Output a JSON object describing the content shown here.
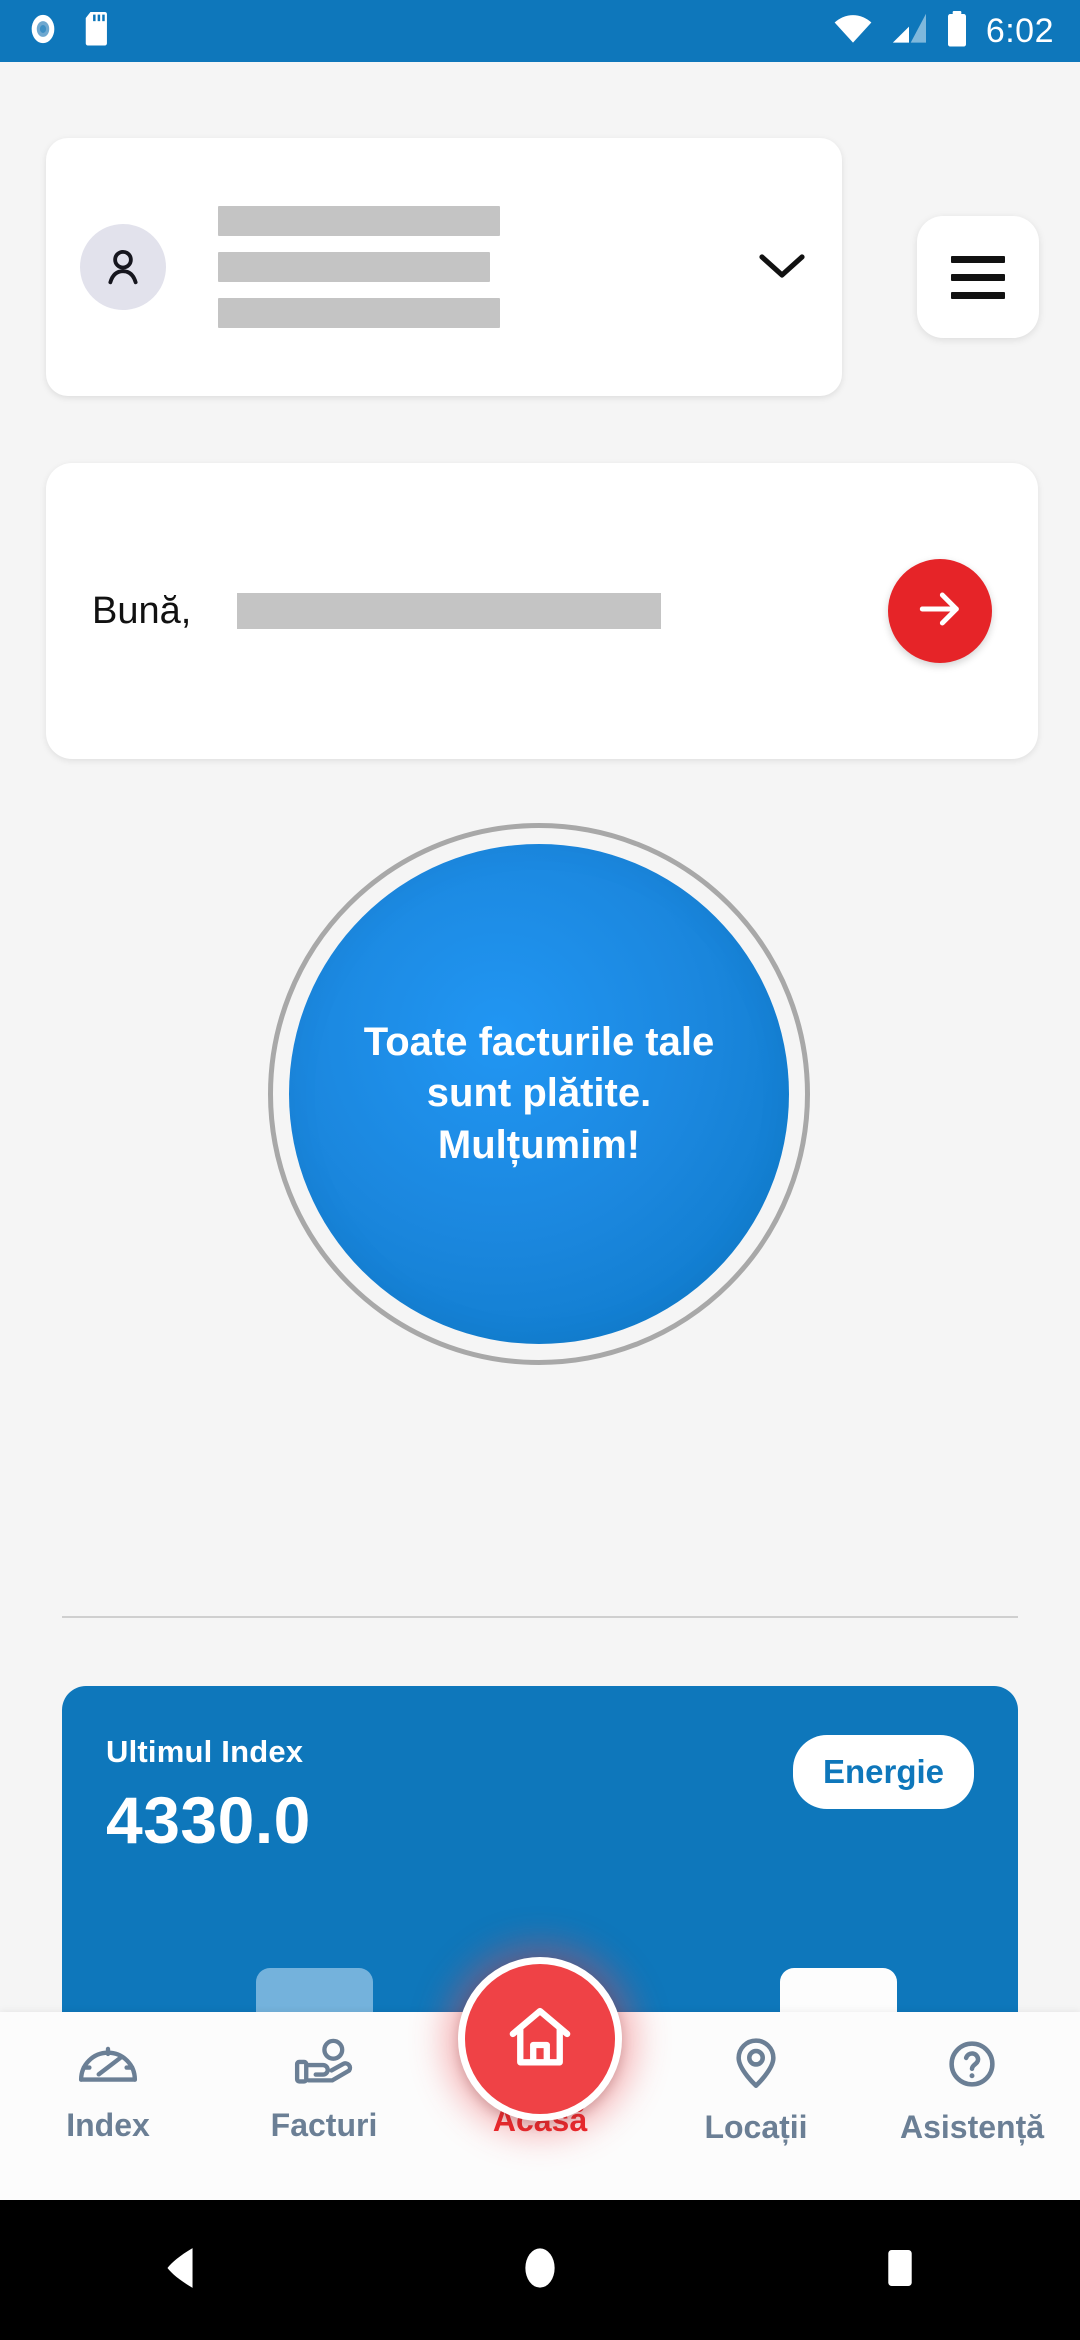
{
  "statusbar": {
    "clock": "6:02",
    "icons": [
      "record-indicator-icon",
      "sd-card-icon",
      "wifi-icon",
      "cellular-signal-icon",
      "battery-icon"
    ],
    "background_color": "#0E77BB"
  },
  "account_card": {
    "avatar_icon": "person-icon",
    "redacted_lines": 3,
    "expand_icon": "chevron-down-icon"
  },
  "menu_button": {
    "icon": "hamburger-menu-icon"
  },
  "greeting": {
    "text": "Bună,",
    "name_redacted": true,
    "action_icon": "arrow-right-icon",
    "action_color": "#E62428"
  },
  "status_circle": {
    "message": "Toate facturile tale sunt plătite. Mulțumim!",
    "fill_color": "#1B87DE",
    "ring_color": "#A8A8A8"
  },
  "index_card": {
    "label": "Ultimul Index",
    "value": "4330.0",
    "badge": "Energie",
    "background_color": "#0E77BB"
  },
  "bottom_nav": {
    "items": [
      {
        "label": "Index",
        "icon": "speedometer-icon",
        "active": false
      },
      {
        "label": "Facturi",
        "icon": "hand-holding-coin-icon",
        "active": false
      },
      {
        "label": "Acasă",
        "icon": "home-icon",
        "active": true
      },
      {
        "label": "Locații",
        "icon": "map-pin-icon",
        "active": false
      },
      {
        "label": "Asistență",
        "icon": "question-circle-icon",
        "active": false
      }
    ],
    "active_color": "#E62428",
    "inactive_color": "#6B7F95"
  },
  "system_nav": {
    "back": "back-triangle-icon",
    "home": "home-circle-icon",
    "recents": "recents-square-icon"
  }
}
